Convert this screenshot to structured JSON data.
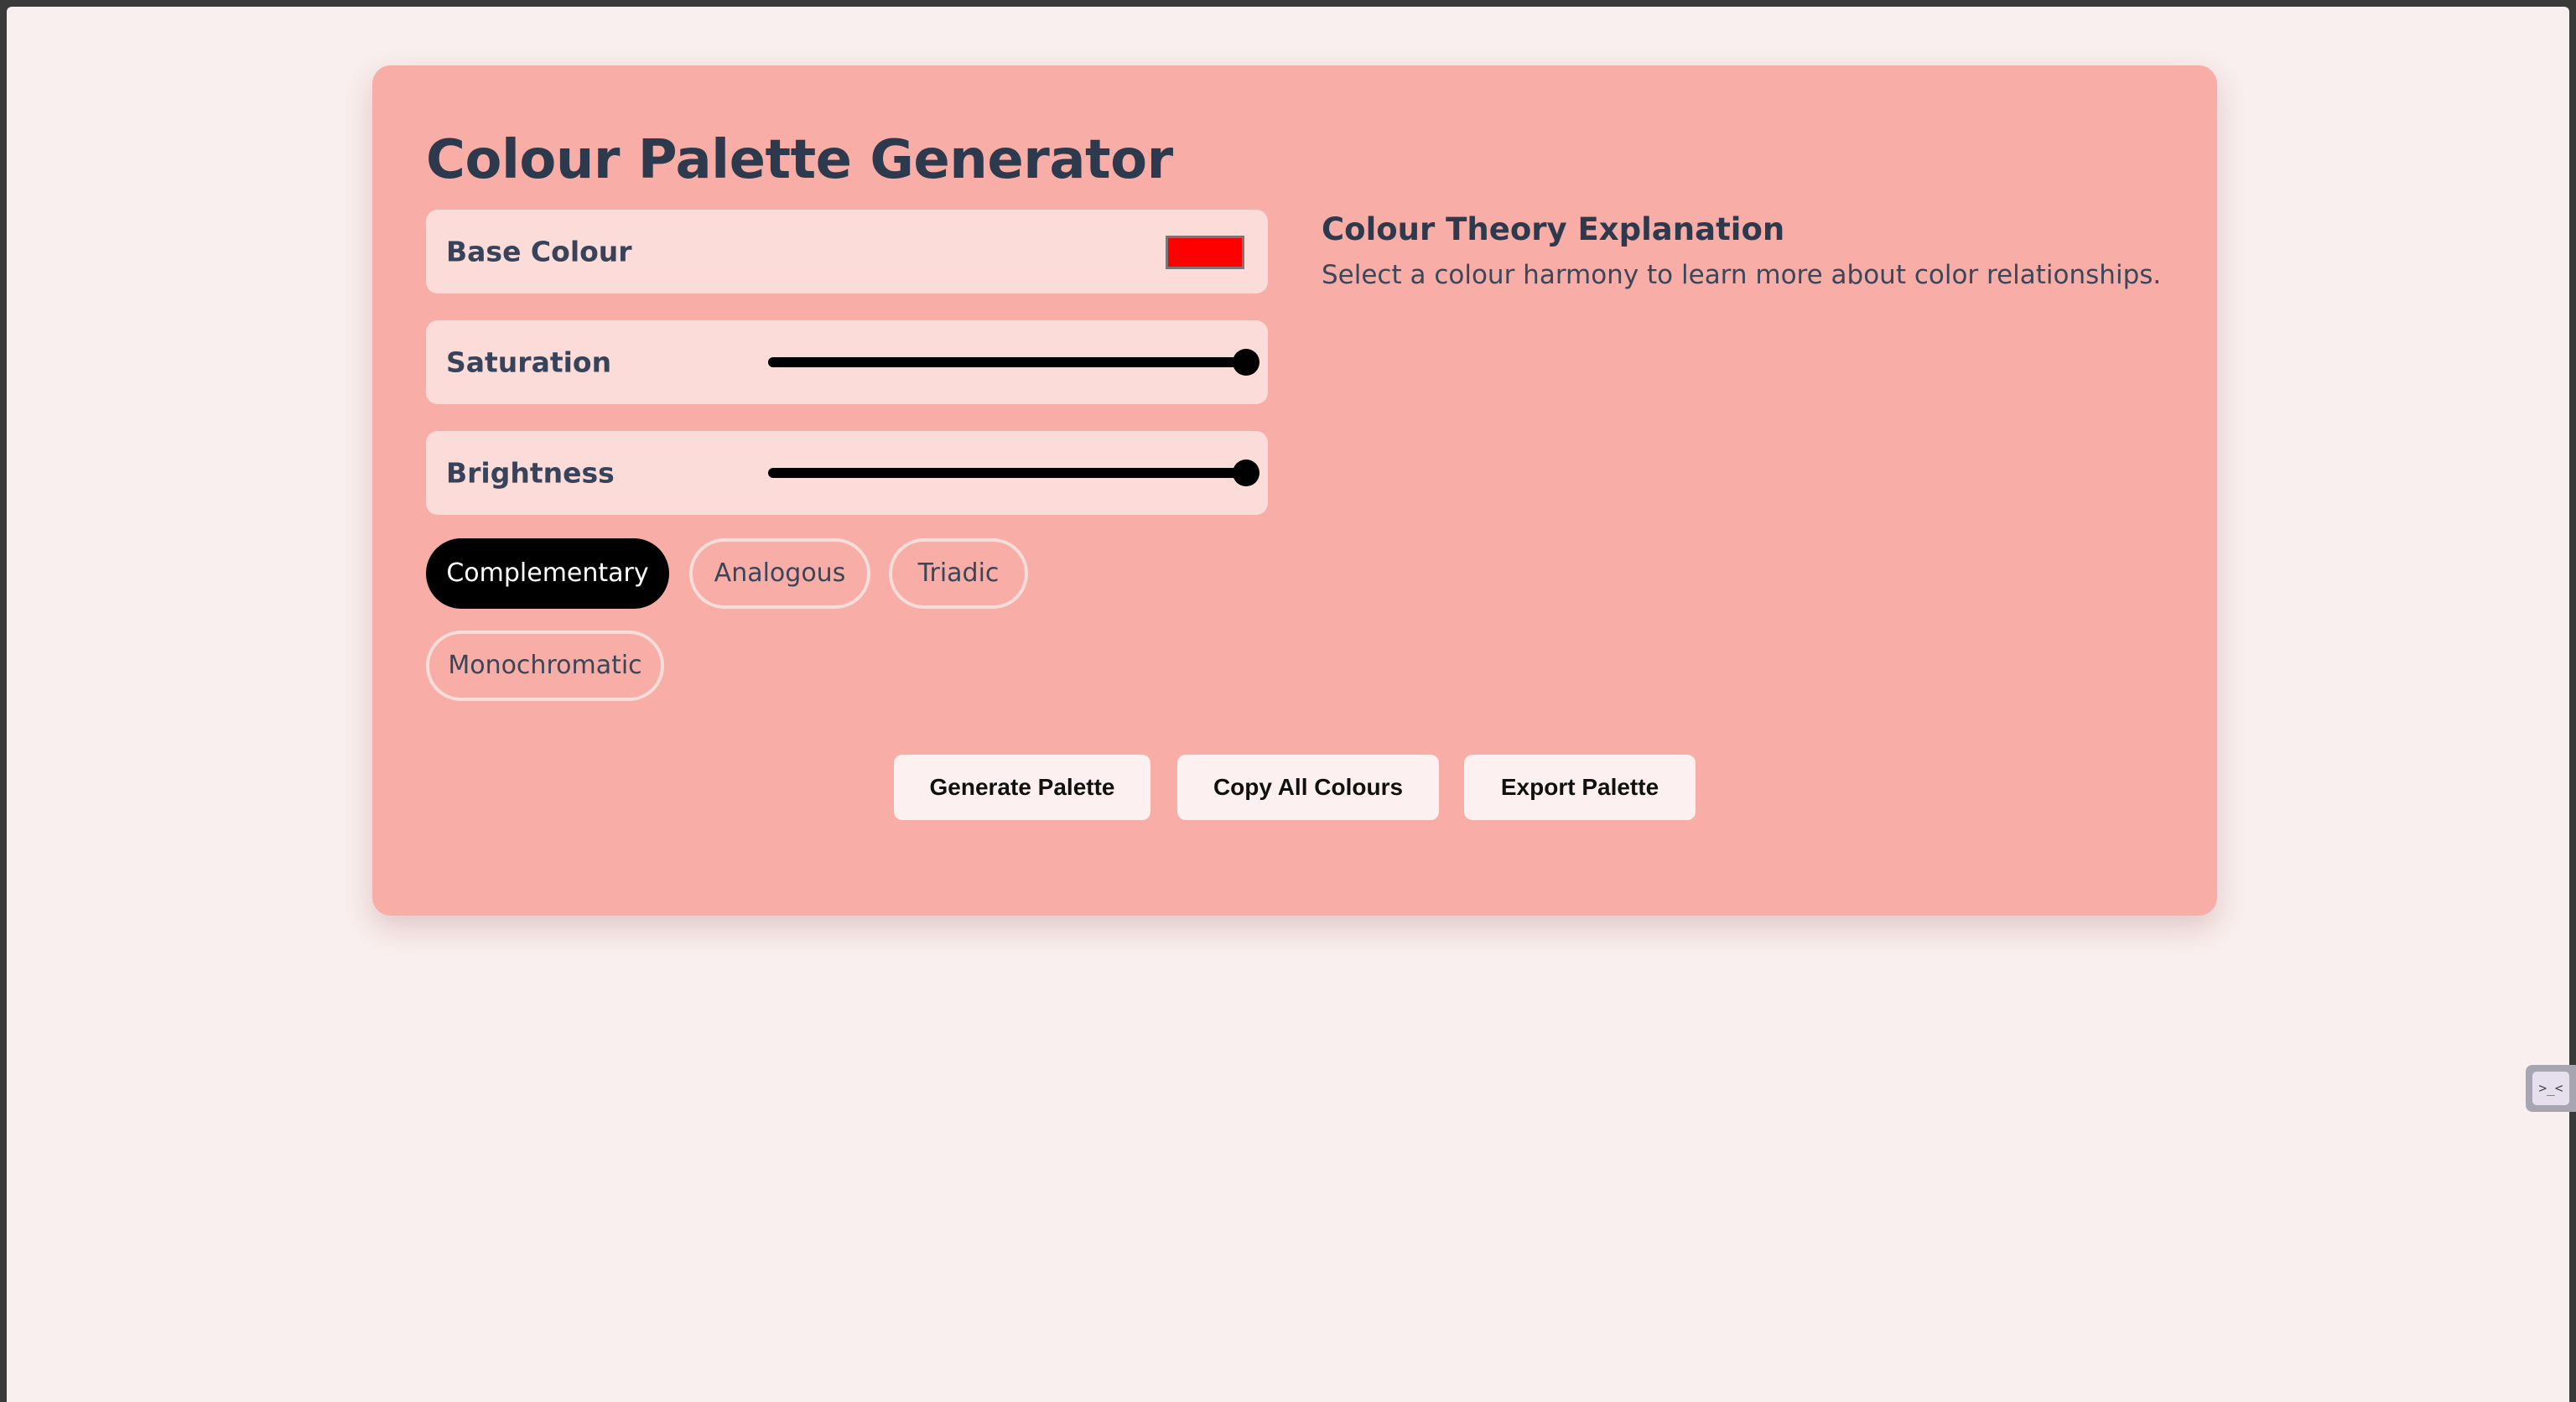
{
  "app": {
    "title": "Colour Palette Generator"
  },
  "controls": {
    "base_colour": {
      "label": "Base Colour",
      "value": "#ff0000"
    },
    "saturation": {
      "label": "Saturation",
      "value_percent": 100
    },
    "brightness": {
      "label": "Brightness",
      "value_percent": 100
    }
  },
  "harmonies": [
    {
      "label": "Complementary",
      "active": true
    },
    {
      "label": "Analogous",
      "active": false
    },
    {
      "label": "Triadic",
      "active": false
    },
    {
      "label": "Monochromatic",
      "active": false
    }
  ],
  "actions": {
    "generate": "Generate Palette",
    "copy_all": "Copy All Colours",
    "export": "Export Palette"
  },
  "theory": {
    "title": "Colour Theory Explanation",
    "text": "Select a colour harmony to learn more about color relationships."
  },
  "widget": {
    "icon": "terminal-icon",
    "glyph": ">_<"
  },
  "colors": {
    "page_background": "#f9efee",
    "card_background": "#f8aea6",
    "control_background": "#fbdcd9",
    "active_button": "#000000",
    "heading_text": "#2d3a4e"
  }
}
